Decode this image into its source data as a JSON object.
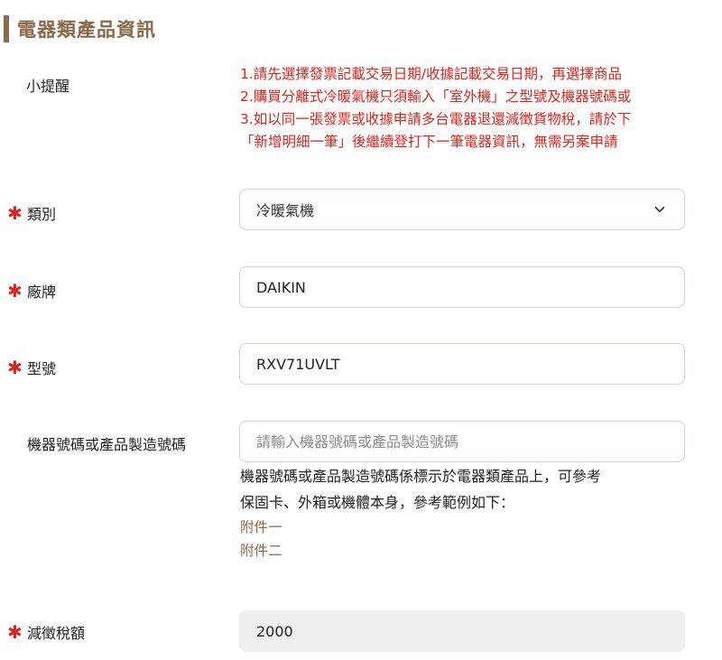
{
  "section": {
    "title": "電器類產品資訊"
  },
  "reminder": {
    "label": "小提醒",
    "lines": [
      "1.請先選擇發票記載交易日期/收據記載交易日期，再選擇商品",
      "2.購買分離式冷暖氣機只須輸入「室外機」之型號及機器號碼或",
      "3.如以同一張發票或收據申請多台電器退還減徵貨物稅，請於下",
      "「新增明細一筆」後繼續登打下一筆電器資訊，無需另案申請"
    ]
  },
  "fields": {
    "category": {
      "required_mark": "✱",
      "label": "類別",
      "value": "冷暖氣機"
    },
    "brand": {
      "required_mark": "✱",
      "label": "廠牌",
      "value": "DAIKIN"
    },
    "model": {
      "required_mark": "✱",
      "label": "型號",
      "value": "RXV71UVLT"
    },
    "serial": {
      "label": "機器號碼或產品製造號碼",
      "placeholder": "請輸入機器號碼或產品製造號碼",
      "help_line1": "機器號碼或產品製造號碼係標示於電器類產品上，可參考",
      "help_line2": "保固卡、外箱或機體本身，參考範例如下：",
      "attachment1": "附件一",
      "attachment2": "附件二"
    },
    "tax": {
      "required_mark": "✱",
      "label": "減徵稅額",
      "value": "2000"
    }
  },
  "colors": {
    "accent": "#8a6a4a",
    "required": "#e0231b",
    "border": "#d9d2c4",
    "disabled_bg": "#efefef"
  },
  "icons": {
    "select_arrow": "chevron-down-icon"
  }
}
